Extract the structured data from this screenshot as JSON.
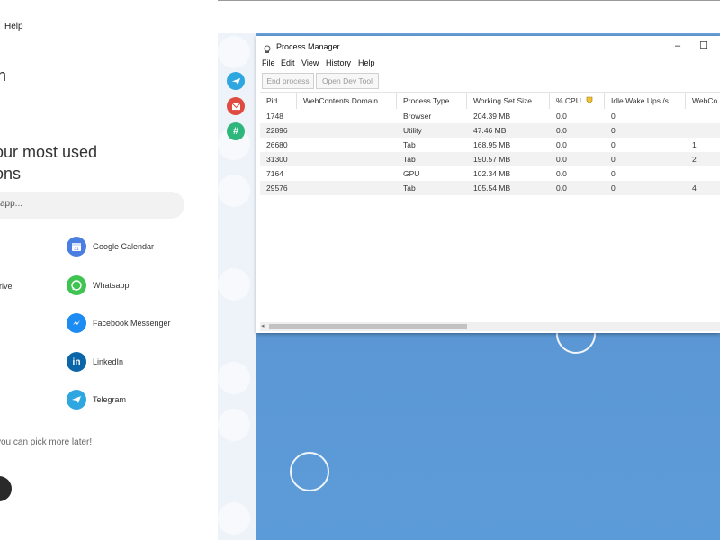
{
  "left": {
    "menu_help": "Help",
    "fragment_h": "n",
    "heading_line1": "our most used",
    "heading_line2": "ons",
    "search_placeholder": "app...",
    "drive_fragment": "rive",
    "apps": [
      {
        "label": "Google Calendar",
        "icon": "google-calendar-icon",
        "color": "#4a7ee0"
      },
      {
        "label": "Whatsapp",
        "icon": "whatsapp-icon",
        "color": "#3fc351"
      },
      {
        "label": "Facebook Messenger",
        "icon": "messenger-icon",
        "color": "#1d8cf2"
      },
      {
        "label": "LinkedIn",
        "icon": "linkedin-icon",
        "color": "#0a66a8"
      },
      {
        "label": "Telegram",
        "icon": "telegram-icon",
        "color": "#2ea6df"
      }
    ],
    "hint": "you can pick more later!"
  },
  "rail": {
    "icons": [
      "dribbble-icon",
      "telegram-icon",
      "gmail-icon",
      "slack-icon",
      "github-icon",
      "dropbox-icon",
      "cloud-icon",
      "discord-icon",
      "whatsapp-icon"
    ],
    "colors": {
      "telegram": "#2ea6df",
      "gmail": "#e04b3f",
      "slack": "#2eb67d"
    }
  },
  "process_manager": {
    "title": "Process Manager",
    "window_controls": [
      "–",
      "☐"
    ],
    "menus": [
      "File",
      "Edit",
      "View",
      "History",
      "Help"
    ],
    "buttons": [
      "End process",
      "Open Dev Tool"
    ],
    "columns": [
      "Pid",
      "WebContents Domain",
      "Process Type",
      "Working Set Size",
      "% CPU",
      "Idle Wake Ups /s",
      "WebCo"
    ],
    "rows": [
      {
        "pid": "1748",
        "domain": "",
        "type": "Browser",
        "ws": "204.39 MB",
        "cpu": "0.0",
        "idle": "0",
        "webco": ""
      },
      {
        "pid": "22896",
        "domain": "",
        "type": "Utility",
        "ws": "47.46 MB",
        "cpu": "0.0",
        "idle": "0",
        "webco": ""
      },
      {
        "pid": "26680",
        "domain": "",
        "type": "Tab",
        "ws": "168.95 MB",
        "cpu": "0.0",
        "idle": "0",
        "webco": "1"
      },
      {
        "pid": "31300",
        "domain": "",
        "type": "Tab",
        "ws": "190.57 MB",
        "cpu": "0.0",
        "idle": "0",
        "webco": "2"
      },
      {
        "pid": "7164",
        "domain": "",
        "type": "GPU",
        "ws": "102.34 MB",
        "cpu": "0.0",
        "idle": "0",
        "webco": ""
      },
      {
        "pid": "29576",
        "domain": "",
        "type": "Tab",
        "ws": "105.54 MB",
        "cpu": "0.0",
        "idle": "0",
        "webco": "4"
      }
    ]
  }
}
